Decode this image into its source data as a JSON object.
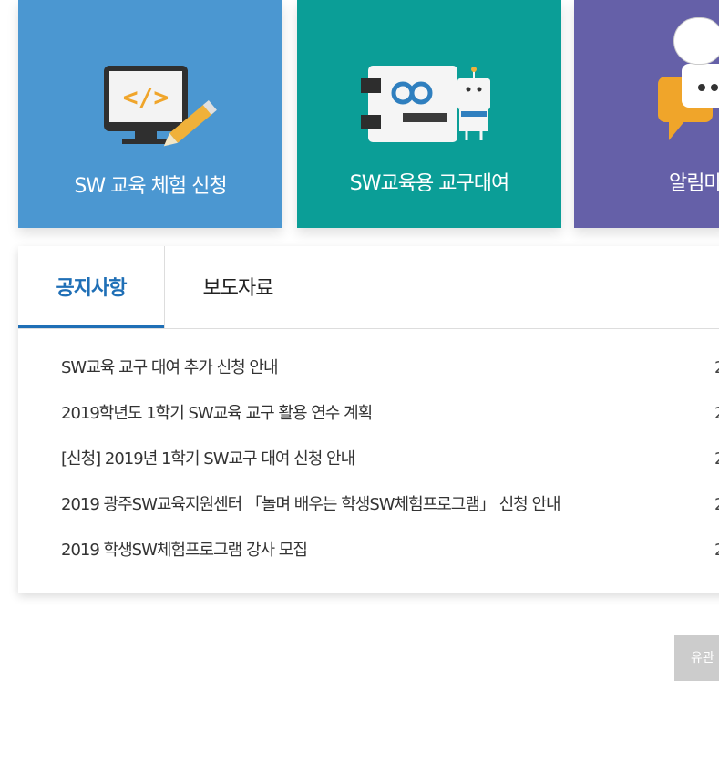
{
  "tiles": [
    {
      "label": "SW 교육 체험 신청",
      "icon": "monitor-code-pencil-icon",
      "color": "#4b97d1"
    },
    {
      "label": "SW교육용 교구대여",
      "icon": "arduino-robot-icon",
      "color": "#0b9e97"
    },
    {
      "label": "알림마",
      "icon": "speech-bubble-icon",
      "color": "#6560a8"
    }
  ],
  "tabs": {
    "notice": "공지사항",
    "press": "보도자료"
  },
  "notices": [
    {
      "title": "SW교육 교구 대여 추가 신청 안내",
      "date": "2"
    },
    {
      "title": "2019학년도 1학기 SW교육 교구 활용 연수 계획",
      "date": "2"
    },
    {
      "title": "[신청] 2019년 1학기 SW교구 대여 신청 안내",
      "date": "2"
    },
    {
      "title": "2019  광주SW교육지원센터 「놀며 배우는 학생SW체험프로그램」 신청 안내",
      "date": "2"
    },
    {
      "title": "2019 학생SW체험프로그램 강사 모집",
      "date": "2"
    }
  ],
  "bottom_button": "유관"
}
